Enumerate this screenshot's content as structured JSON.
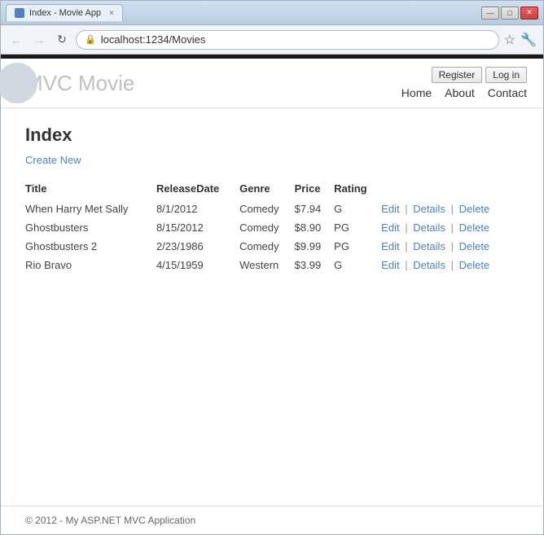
{
  "window": {
    "title": "Index - Movie App",
    "tab_close": "×"
  },
  "controls": {
    "minimize": "—",
    "maximize": "□",
    "close": "✕"
  },
  "addressbar": {
    "url": "localhost:1234/Movies",
    "star_icon": "☆",
    "tool_icon": "🔧"
  },
  "nav": {
    "back": "←",
    "forward": "→",
    "refresh": "↻"
  },
  "header": {
    "app_title": "MVC Movie",
    "register_label": "Register",
    "login_label": "Log in",
    "nav_links": [
      {
        "label": "Home"
      },
      {
        "label": "About"
      },
      {
        "label": "Contact"
      }
    ]
  },
  "main": {
    "page_title": "Index",
    "create_new_label": "Create New",
    "table": {
      "columns": [
        "Title",
        "ReleaseDate",
        "Genre",
        "Price",
        "Rating",
        ""
      ],
      "rows": [
        {
          "title": "When Harry Met Sally",
          "release": "8/1/2012",
          "genre": "Comedy",
          "price": "$7.94",
          "rating": "G"
        },
        {
          "title": "Ghostbusters",
          "release": "8/15/2012",
          "genre": "Comedy",
          "price": "$8.90",
          "rating": "PG"
        },
        {
          "title": "Ghostbusters 2",
          "release": "2/23/1986",
          "genre": "Comedy",
          "price": "$9.99",
          "rating": "PG"
        },
        {
          "title": "Rio Bravo",
          "release": "4/15/1959",
          "genre": "Western",
          "price": "$3.99",
          "rating": "G"
        }
      ],
      "actions": [
        "Edit",
        "|",
        "Details",
        "|",
        "Delete"
      ]
    }
  },
  "footer": {
    "text": "© 2012 - My ASP.NET MVC Application"
  }
}
